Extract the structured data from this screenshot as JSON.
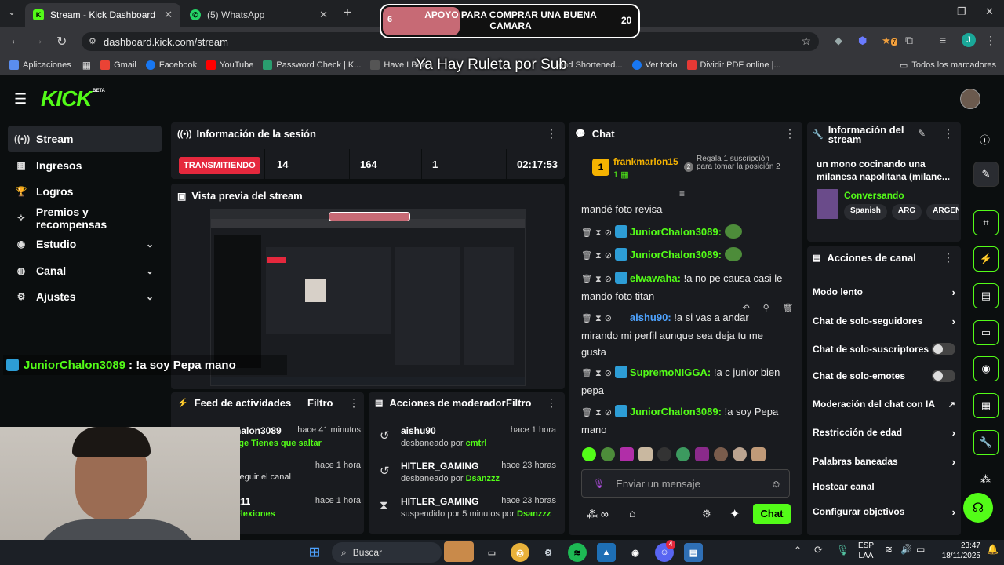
{
  "browser": {
    "tabs": [
      {
        "title": "Stream - Kick Dashboard",
        "active": true
      },
      {
        "title": "(5) WhatsApp",
        "active": false
      }
    ],
    "url": "dashboard.kick.com/stream",
    "bookmarks": [
      "Aplicaciones",
      "Gmail",
      "Facebook",
      "YouTube",
      "Password Check | K...",
      "Have I Bee...",
      "...end Shortened...",
      "Ver todo",
      "Dividir PDF online |..."
    ],
    "all_bookmarks": "Todos los marcadores",
    "profile_initial": "J",
    "ext_badge": "7"
  },
  "overlay": {
    "goal_current": "6",
    "goal_title": "APOYO PARA COMPRAR UNA BUENA CAMARA",
    "goal_target": "20",
    "goal_progress": 0.3,
    "ticker": "Ya Hay Ruleta por Sub",
    "chat_popup_user": "JuniorChalon3089",
    "chat_popup_text": ": !a soy Pepa mano"
  },
  "kick": {
    "logo": "KICK",
    "beta": "BETA",
    "sidebar": [
      {
        "label": "Stream",
        "icon": "broadcast-icon",
        "active": true,
        "chevron": false
      },
      {
        "label": "Ingresos",
        "icon": "chart-icon",
        "active": false,
        "chevron": false
      },
      {
        "label": "Logros",
        "icon": "trophy-icon",
        "active": false,
        "chevron": false
      },
      {
        "label": "Premios y recompensas",
        "icon": "gift-icon",
        "active": false,
        "chevron": false
      },
      {
        "label": "Estudio",
        "icon": "camera-icon",
        "active": false,
        "chevron": true
      },
      {
        "label": "Canal",
        "icon": "user-icon",
        "active": false,
        "chevron": true
      },
      {
        "label": "Ajustes",
        "icon": "gear-icon",
        "active": false,
        "chevron": true
      }
    ],
    "session": {
      "title": "Información de la sesión",
      "status": "TRANSMITIENDO",
      "viewers": "14",
      "followers": "164",
      "subs": "1",
      "duration": "02:17:53"
    },
    "preview": {
      "title": "Vista previa del stream"
    },
    "activity": {
      "title": "Feed de actividades",
      "filter": "Filtro",
      "items": [
        {
          "user": "halon3089",
          "time": "hace 41 minutos",
          "sub": "rge Tienes que saltar"
        },
        {
          "user": "",
          "time": "hace 1 hora",
          "sub": "seguir el canal"
        },
        {
          "user": "x11",
          "time": "hace 1 hora",
          "sub": "Flexiones"
        }
      ]
    },
    "modactions": {
      "title": "Acciones de moderador",
      "filter": "Filtro",
      "items": [
        {
          "user": "aishu90",
          "time": "hace 1 hora",
          "action": "desbaneado por",
          "by": "cmtrl"
        },
        {
          "user": "HITLER_GAMING",
          "time": "hace 23 horas",
          "action": "desbaneado por",
          "by": "Dsanzzz"
        },
        {
          "user": "HITLER_GAMING",
          "time": "hace 23 horas",
          "action": "suspendido por 5 minutos por",
          "by": "Dsanzzz"
        }
      ]
    },
    "chat": {
      "title": "Chat",
      "pinned_user": "frankmarlon15",
      "pinned_count": "1",
      "pinned_rank": "1",
      "gift_text": "Regala 1 suscripción para tomar la posición 2",
      "messages": [
        {
          "user": "",
          "text": "mandé foto revisa",
          "color": "#ffffff"
        },
        {
          "user": "JuniorChalon3089:",
          "text": "",
          "color": "#53fc18"
        },
        {
          "user": "JuniorChalon3089:",
          "text": "",
          "color": "#53fc18"
        },
        {
          "user": "elwawaha:",
          "text": "!a no pe causa casi le mando foto titan",
          "color": "#53fc18"
        },
        {
          "user": "aishu90:",
          "text": "!a si vas a andar mirando mi perfil aunque sea deja tu me gusta",
          "color": "#4ea3ff"
        },
        {
          "user": "SupremoNIGGA:",
          "text": "!a c junior bien pepa",
          "color": "#53fc18"
        },
        {
          "user": "JuniorChalon3089:",
          "text": "!a soy Pepa mano",
          "color": "#53fc18"
        }
      ],
      "placeholder": "Enviar un mensaje",
      "send_label": "Chat"
    },
    "stream_info": {
      "title": "Información del stream",
      "stream_title": "un mono cocinando una milanesa napolitana (milane...",
      "category": "Conversando",
      "tags": [
        "Spanish",
        "ARG",
        "ARGEN"
      ]
    },
    "channel_actions": {
      "title": "Acciones de canal",
      "items": [
        {
          "label": "Modo lento",
          "control": "chevron"
        },
        {
          "label": "Chat de solo-seguidores",
          "control": "chevron"
        },
        {
          "label": "Chat de solo-suscriptores",
          "control": "toggle"
        },
        {
          "label": "Chat de solo-emotes",
          "control": "toggle"
        },
        {
          "label": "Moderación del chat con IA",
          "control": "external"
        },
        {
          "label": "Restricción de edad",
          "control": "chevron"
        },
        {
          "label": "Palabras baneadas",
          "control": "chevron"
        },
        {
          "label": "Hostear canal",
          "control": "none"
        },
        {
          "label": "Configurar objetivos",
          "control": "chevron"
        }
      ]
    }
  },
  "taskbar": {
    "search": "Buscar",
    "lang": "ESP",
    "lang2": "LAA",
    "time": "23:47",
    "date": "18/11/2025",
    "discord_badge": "4"
  },
  "colors": {
    "kick_green": "#53fc18",
    "live_red": "#e5283d",
    "panel": "#191b1f"
  }
}
